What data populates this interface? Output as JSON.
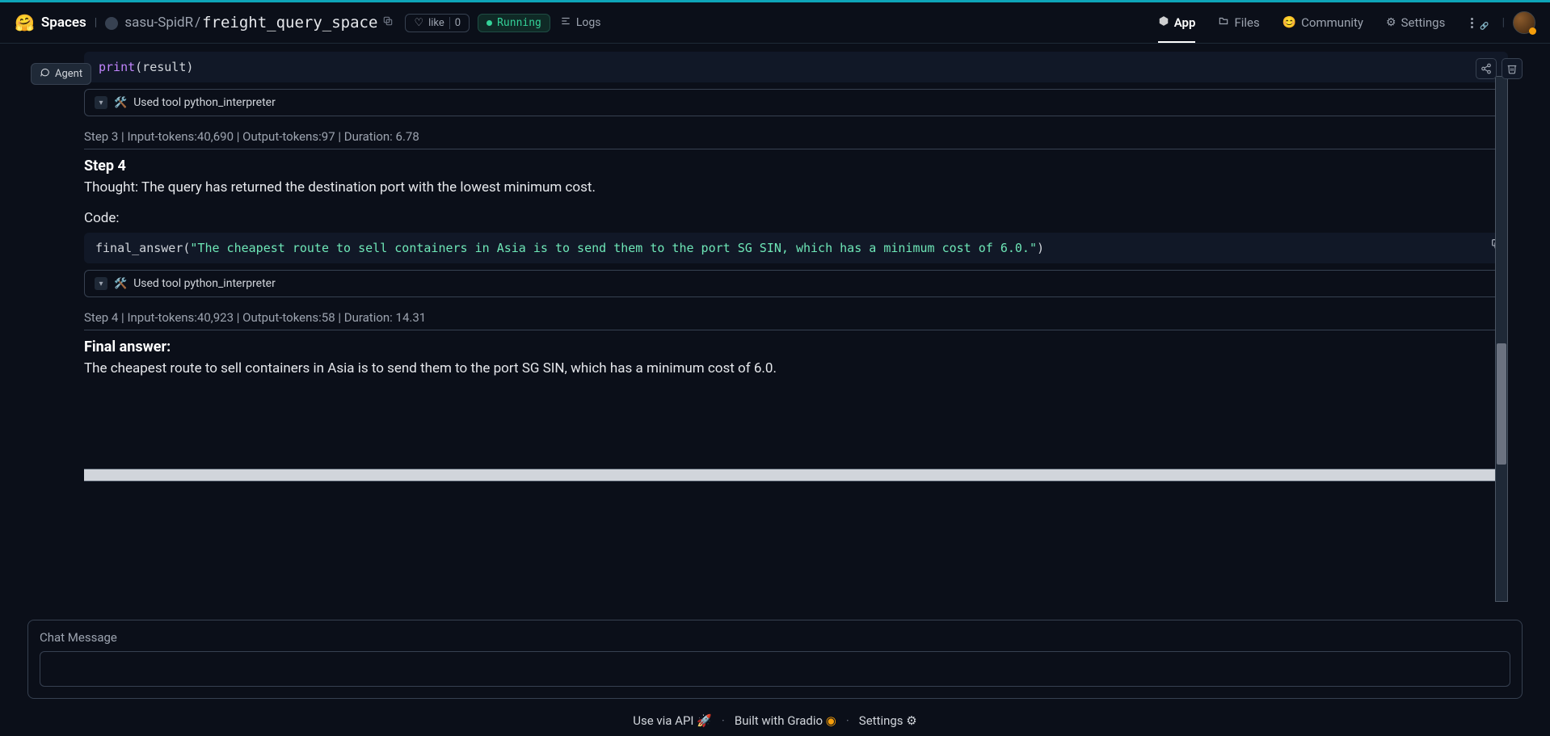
{
  "header": {
    "brand": "Spaces",
    "owner": "sasu-SpidR",
    "space": "freight_query_space",
    "like_label": "like",
    "like_count": "0",
    "status": "Running",
    "logs": "Logs"
  },
  "nav": {
    "app": "App",
    "files": "Files",
    "community": "Community",
    "settings": "Settings"
  },
  "agent_tab": "Agent",
  "code_top_fn": "print",
  "code_top_arg": "(result)",
  "tool_row": "Used tool python_interpreter",
  "step3_meta": "Step 3 | Input-tokens:40,690 | Output-tokens:97 | Duration: 6.78",
  "step4_title": "Step 4",
  "step4_thought": "Thought: The query has returned the destination port with the lowest minimum cost.",
  "code_label": "Code:",
  "code4_fn": "final_answer",
  "code4_paren_open": "(",
  "code4_str": "\"The cheapest route to sell containers in Asia is to send them to the port SG SIN, which has a minimum cost of 6.0.\"",
  "code4_paren_close": ")",
  "step4_meta": "Step 4 | Input-tokens:40,923 | Output-tokens:58 | Duration: 14.31",
  "final_head": "Final answer:",
  "final_body": "The cheapest route to sell containers in Asia is to send them to the port SG SIN, which has a minimum cost of 6.0.",
  "input_label": "Chat Message",
  "footer": {
    "api": "Use via API",
    "built": "Built with Gradio",
    "settings": "Settings"
  }
}
